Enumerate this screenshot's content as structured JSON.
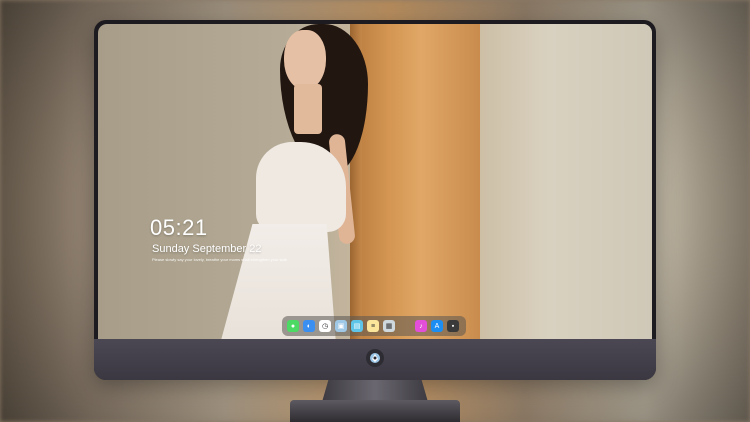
{
  "lockscreen": {
    "time": "05:21",
    "date": "Sunday September  22",
    "tagline": "Please slowly say your lovely, breathe your moms shall strengthen your sole"
  },
  "dock": {
    "items": [
      {
        "name": "messages-icon",
        "color": "#4cd964",
        "glyph": "●"
      },
      {
        "name": "finder-icon",
        "color": "#3b8ff0",
        "glyph": "◐"
      },
      {
        "name": "clock-icon",
        "color": "#ffffff",
        "glyph": "◷"
      },
      {
        "name": "preview-icon",
        "color": "#9fc7e6",
        "glyph": "▣"
      },
      {
        "name": "clapper-icon",
        "color": "#5ec4e8",
        "glyph": "▤"
      },
      {
        "name": "notes-icon",
        "color": "#fbe59a",
        "glyph": "≡"
      },
      {
        "name": "photos-icon",
        "color": "#cfd8dc",
        "glyph": "▦"
      },
      {
        "name": "music-icon",
        "color": "#e34fd8",
        "glyph": "♪"
      },
      {
        "name": "appstore-icon",
        "color": "#1c8ef2",
        "glyph": "A"
      },
      {
        "name": "calculator-icon",
        "color": "#3a3a3a",
        "glyph": "▪"
      }
    ]
  },
  "colors": {
    "bezel": "#1d1b20",
    "chin": "#4b4753",
    "clock_text": "#ffffff"
  }
}
